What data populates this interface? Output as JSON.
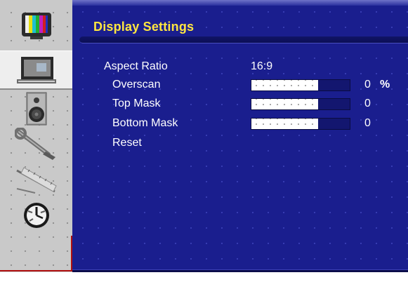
{
  "menu": {
    "title": "Display Settings",
    "rows": {
      "aspect_ratio": {
        "label": "Aspect Ratio",
        "value": "16:9"
      },
      "overscan": {
        "label": "Overscan",
        "value": "0",
        "unit": "%",
        "level": 0.68
      },
      "top_mask": {
        "label": "Top Mask",
        "value": "0",
        "level": 0.68
      },
      "bottom_mask": {
        "label": "Bottom Mask",
        "value": "0",
        "level": 0.68
      },
      "reset": {
        "label": "Reset"
      }
    }
  },
  "sidebar": {
    "items": [
      {
        "icon": "tv-color-bars-icon",
        "selected": false
      },
      {
        "icon": "monitor-display-icon",
        "selected": true
      },
      {
        "icon": "speaker-icon",
        "selected": false
      },
      {
        "icon": "wrench-icon",
        "selected": false
      },
      {
        "icon": "ruler-scale-icon",
        "selected": false
      },
      {
        "icon": "clock-icon",
        "selected": false
      }
    ]
  },
  "colors": {
    "panel_bg": "#1a1e8e",
    "title": "#ffe640",
    "text": "#ffffff",
    "sidebar_bg": "#c9c9c9",
    "accent_red": "#b01010"
  }
}
